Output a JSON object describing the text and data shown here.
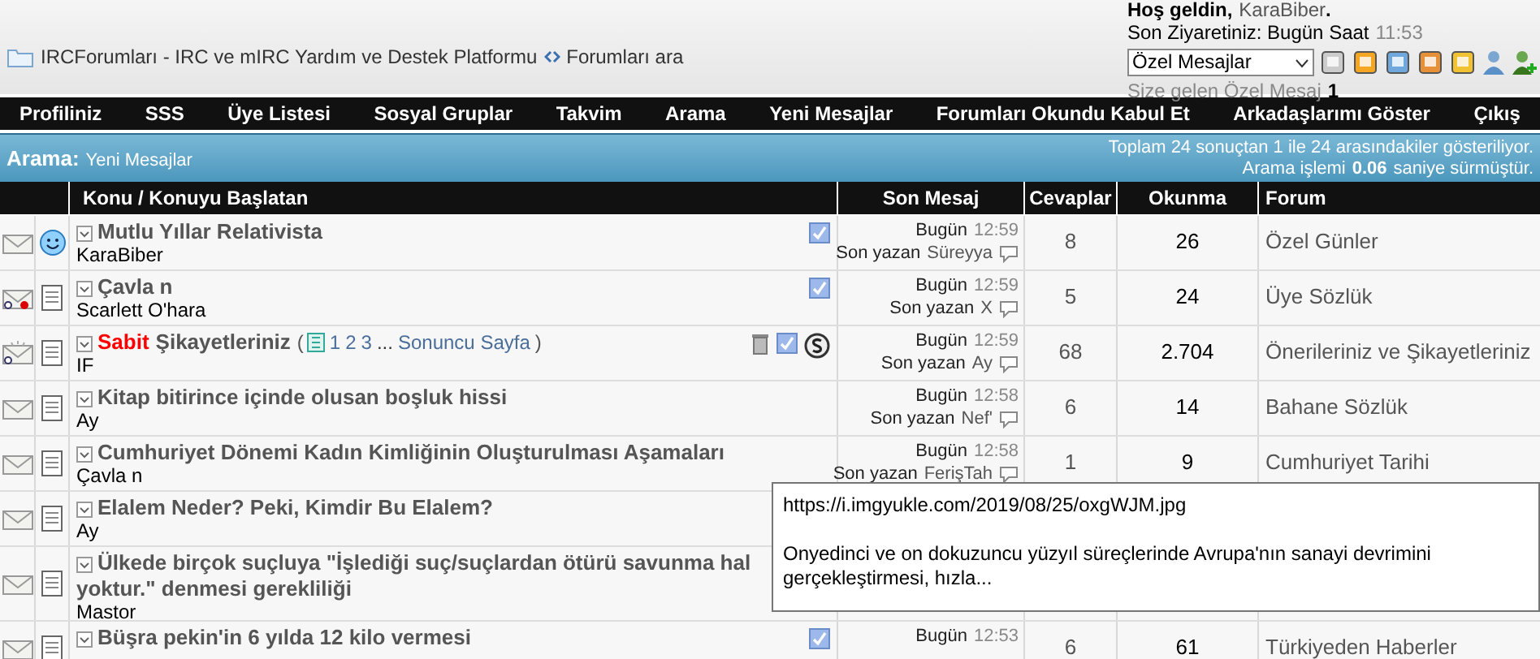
{
  "header": {
    "breadcrumb": "IRCForumları - IRC ve mIRC Yardım ve Destek Platformu",
    "search_link": "Forumları ara",
    "welcome": "Hoş geldin,",
    "user": "KaraBiber",
    "welcome_end": ".",
    "last_visit": "Son Ziyaretiniz: Bugün Saat",
    "last_visit_time": "11:53",
    "select": "Özel Mesajlar",
    "pm_label": "Size gelen Özel Mesaj",
    "pm_count": "1"
  },
  "nav": [
    "Profiliniz",
    "SSS",
    "Üye Listesi",
    "Sosyal Gruplar",
    "Takvim",
    "Arama",
    "Yeni Mesajlar",
    "Forumları Okundu Kabul Et",
    "Arkadaşlarımı Göster",
    "Çıkış"
  ],
  "search_bar": {
    "title": "Arama:",
    "subtitle": "Yeni Mesajlar",
    "summary": "Toplam 24 sonuçtan 1 ile 24 arasındakiler gösteriliyor.",
    "time_pre": "Arama işlemi",
    "time": "0.06",
    "time_post": "saniye sürmüştür."
  },
  "table": {
    "columns": [
      "Konu / Konuyu Başlatan",
      "Son Mesaj",
      "Cevaplar",
      "Okunma",
      "Forum"
    ],
    "rows": [
      {
        "locked": false,
        "hot": false,
        "smiley": true,
        "title": "Mutlu Yıllar Relativista",
        "author": "KaraBiber",
        "tools": [
          {
            "kind": "check"
          }
        ],
        "date": "Bugün",
        "time": "12:59",
        "by": "Son yazan",
        "last_user": "Süreyya",
        "replies": "8",
        "views": "26",
        "forum": "Özel Günler"
      },
      {
        "locked": true,
        "hot": false,
        "smiley": false,
        "title": "Çavla n",
        "author": "Scarlett O'hara",
        "tools": [
          {
            "kind": "check"
          }
        ],
        "date": "Bugün",
        "time": "12:59",
        "by": "Son yazan",
        "last_user": "X",
        "replies": "5",
        "views": "24",
        "forum": "Üye Sözlük"
      },
      {
        "locked": false,
        "hot": true,
        "smiley": false,
        "prefix": "Sabit",
        "title": "Şikayetleriniz",
        "pagination": {
          "open": "(",
          "pages": [
            "1",
            "2",
            "3"
          ],
          "ellipsis": "...",
          "last": "Sonuncu Sayfa",
          "close": ")"
        },
        "author": "IF",
        "tools": [
          {
            "kind": "trash"
          },
          {
            "kind": "check"
          },
          {
            "kind": "sticky"
          }
        ],
        "date": "Bugün",
        "time": "12:59",
        "by": "Son yazan",
        "last_user": "Ay",
        "replies": "68",
        "views": "2.704",
        "forum": "Önerileriniz ve Şikayetleriniz"
      },
      {
        "locked": false,
        "hot": false,
        "smiley": false,
        "title": "Kitap bitirince içinde olusan boşluk hissi",
        "author": "Ay",
        "tools": [],
        "date": "Bugün",
        "time": "12:58",
        "by": "Son yazan",
        "last_user": "Nef'",
        "replies": "6",
        "views": "14",
        "forum": "Bahane Sözlük"
      },
      {
        "locked": false,
        "hot": false,
        "smiley": false,
        "title": "Cumhuriyet Dönemi Kadın Kimliğinin Oluşturulması Aşamaları",
        "author": "Çavla n",
        "tools": [],
        "date": "Bugün",
        "time": "12:58",
        "by": "Son yazan",
        "last_user": "FerişTah",
        "replies": "1",
        "views": "9",
        "forum": "Cumhuriyet Tarihi"
      },
      {
        "locked": false,
        "hot": false,
        "smiley": false,
        "title": "Elalem Neder? Peki, Kimdir Bu Elalem?",
        "author": "Ay",
        "tools": []
      },
      {
        "locked": false,
        "hot": false,
        "smiley": false,
        "title": "Ülkede birçok suçluya \"İşlediği suç/suçlardan ötürü savunma hal",
        "title_2": "yoktur.\" denmesi gerekliliği",
        "author": "Mastor",
        "tools": []
      },
      {
        "locked": false,
        "hot": false,
        "smiley": false,
        "title": "Büşra pekin'in 6 yılda 12 kilo vermesi",
        "tools": [
          {
            "kind": "check"
          }
        ],
        "date": "Bugün",
        "time": "12:53",
        "replies": "6",
        "views": "61",
        "forum": "Türkiyeden Haberler"
      }
    ]
  },
  "tooltip": {
    "url": "https://i.imgyukle.com/2019/08/25/oxgWJM.jpg",
    "text": "Onyedinci ve on dokuzuncu yüzyıl süreçlerinde Avrupa'nın sanayi devrimini gerçekleştirmesi, hızla..."
  }
}
